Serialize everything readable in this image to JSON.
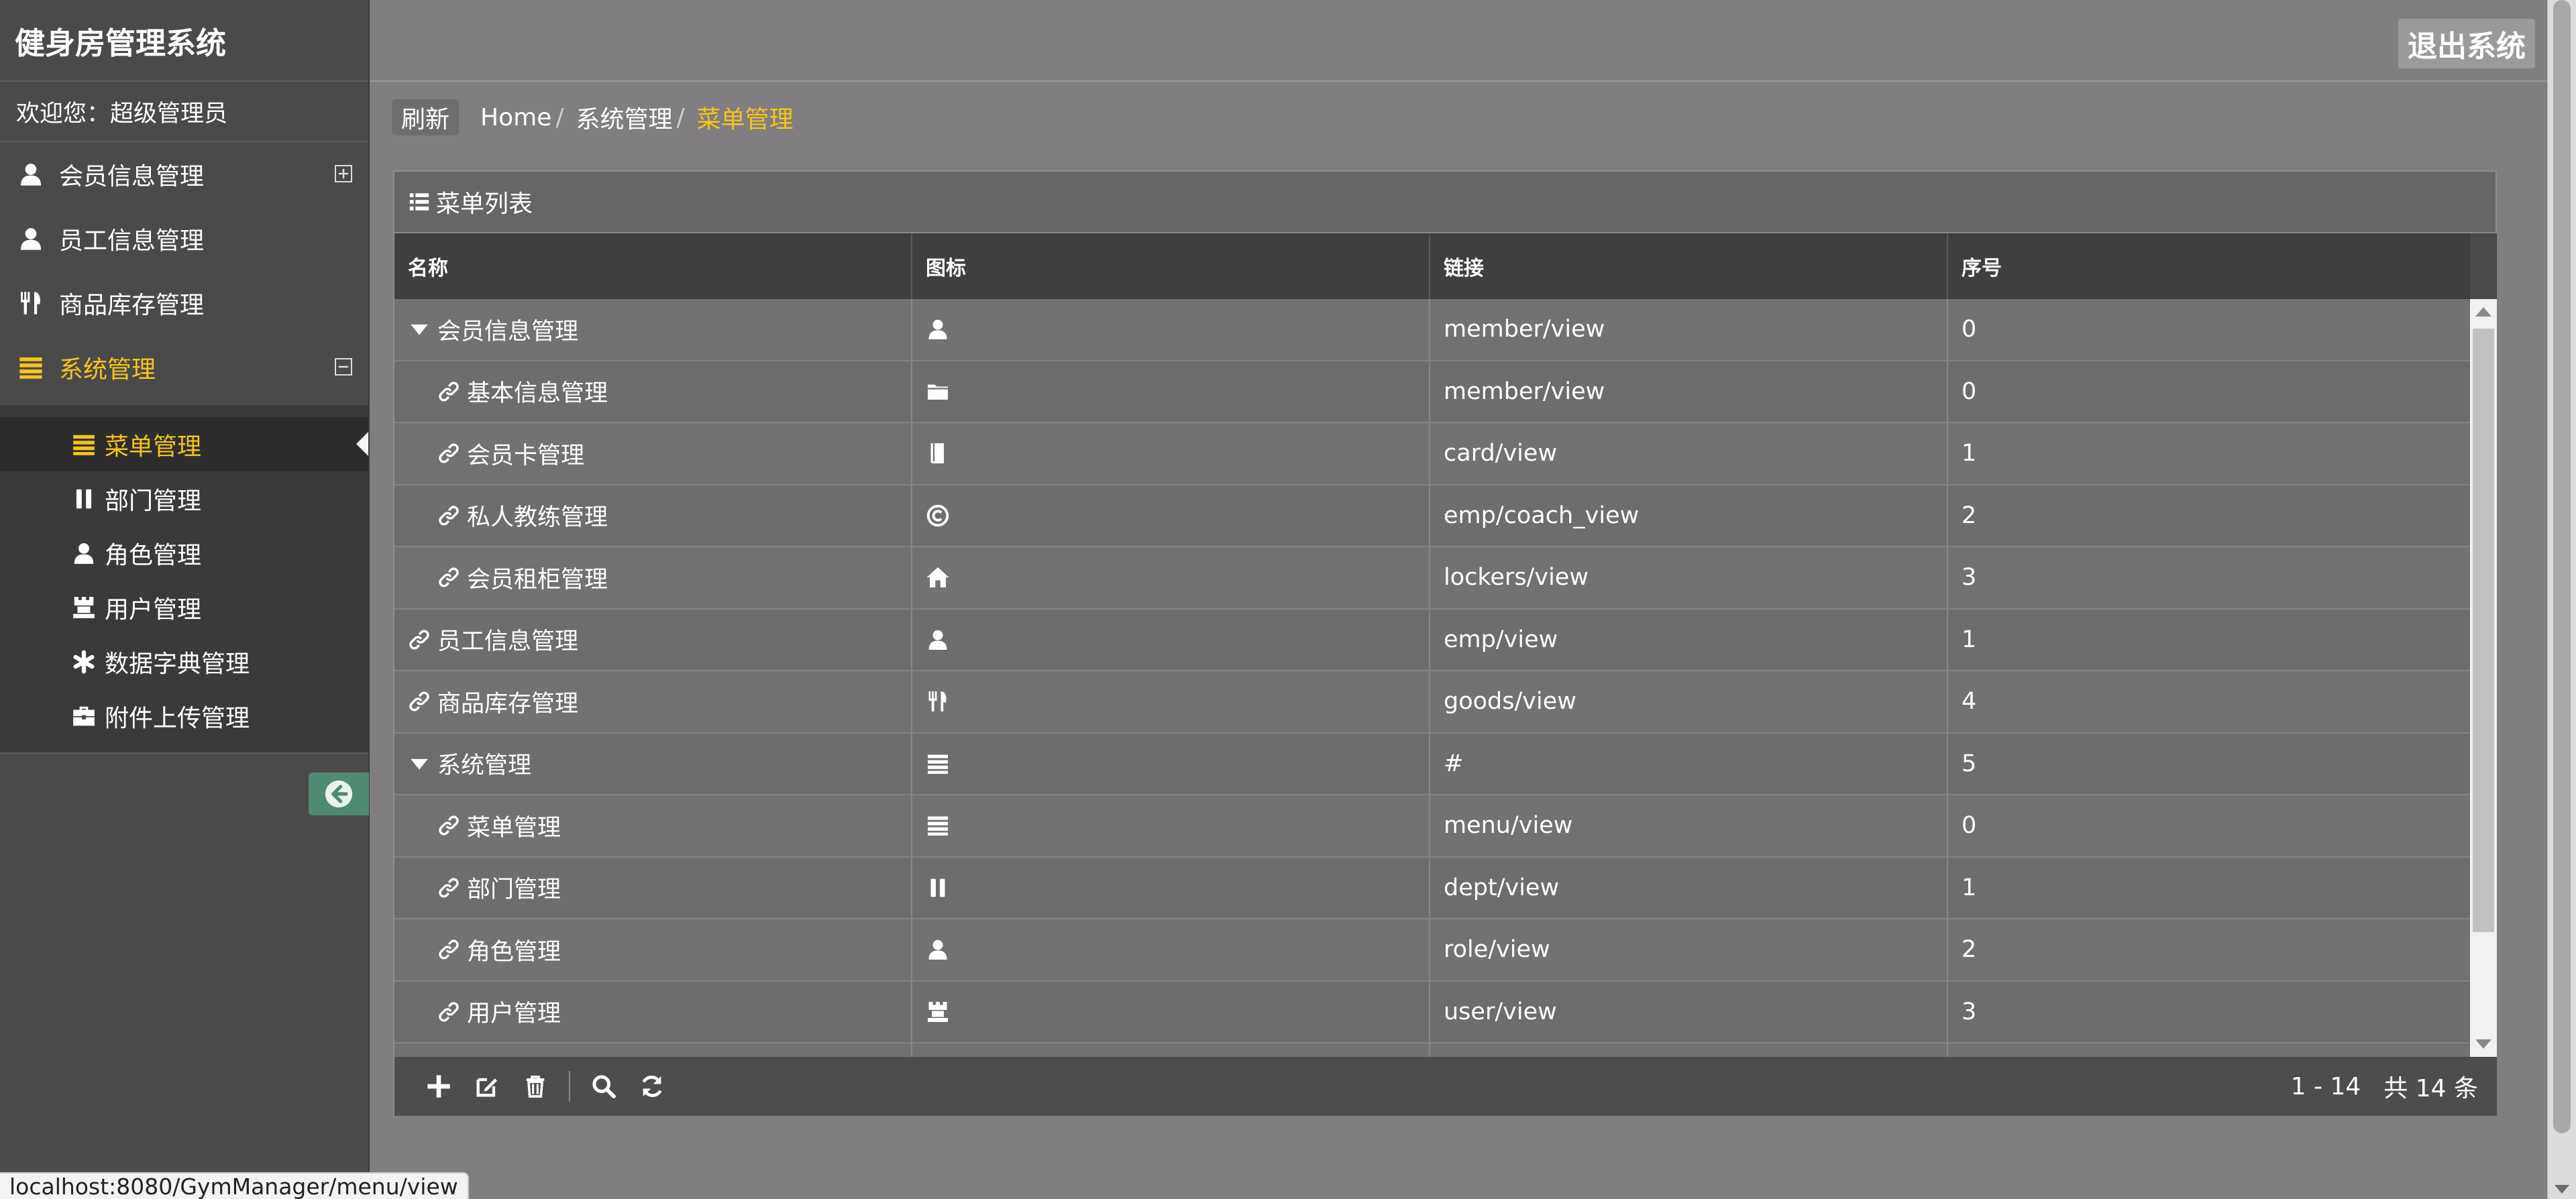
{
  "app": {
    "title": "健身房管理系统",
    "welcome": "欢迎您：超级管理员",
    "logout_label": "退出系统"
  },
  "sidebar": {
    "items": [
      {
        "label": "会员信息管理",
        "icon": "user-icon",
        "toggle": "plus"
      },
      {
        "label": "员工信息管理",
        "icon": "user-icon"
      },
      {
        "label": "商品库存管理",
        "icon": "cutlery-icon"
      },
      {
        "label": "系统管理",
        "icon": "list-icon",
        "toggle": "minus",
        "active": true
      }
    ],
    "subitems": [
      {
        "label": "菜单管理",
        "icon": "list-icon",
        "active": true
      },
      {
        "label": "部门管理",
        "icon": "pause-icon"
      },
      {
        "label": "角色管理",
        "icon": "user-icon"
      },
      {
        "label": "用户管理",
        "icon": "tower-icon"
      },
      {
        "label": "数据字典管理",
        "icon": "asterisk-icon"
      },
      {
        "label": "附件上传管理",
        "icon": "briefcase-icon"
      }
    ]
  },
  "breadcrumb": {
    "refresh_label": "刷新",
    "home": "Home",
    "parent": "系统管理",
    "current": "菜单管理"
  },
  "panel": {
    "title": "菜单列表"
  },
  "grid": {
    "columns": [
      "名称",
      "图标",
      "链接",
      "序号"
    ],
    "rows": [
      {
        "name": "会员信息管理",
        "icon": "user-icon",
        "link": "member/view",
        "order": "0",
        "level": 0,
        "node": "expanded"
      },
      {
        "name": "基本信息管理",
        "icon": "folder-icon",
        "link": "member/view",
        "order": "0",
        "level": 1,
        "node": "leaf"
      },
      {
        "name": "会员卡管理",
        "icon": "book-icon",
        "link": "card/view",
        "order": "1",
        "level": 1,
        "node": "leaf"
      },
      {
        "name": "私人教练管理",
        "icon": "copyright-icon",
        "link": "emp/coach_view",
        "order": "2",
        "level": 1,
        "node": "leaf"
      },
      {
        "name": "会员租柜管理",
        "icon": "home-icon",
        "link": "lockers/view",
        "order": "3",
        "level": 1,
        "node": "leaf"
      },
      {
        "name": "员工信息管理",
        "icon": "user-icon",
        "link": "emp/view",
        "order": "1",
        "level": 0,
        "node": "leaf"
      },
      {
        "name": "商品库存管理",
        "icon": "cutlery-icon",
        "link": "goods/view",
        "order": "4",
        "level": 0,
        "node": "leaf"
      },
      {
        "name": "系统管理",
        "icon": "list-icon",
        "link": "#",
        "order": "5",
        "level": 0,
        "node": "expanded"
      },
      {
        "name": "菜单管理",
        "icon": "list-icon",
        "link": "menu/view",
        "order": "0",
        "level": 1,
        "node": "leaf"
      },
      {
        "name": "部门管理",
        "icon": "pause-icon",
        "link": "dept/view",
        "order": "1",
        "level": 1,
        "node": "leaf"
      },
      {
        "name": "角色管理",
        "icon": "user-icon",
        "link": "role/view",
        "order": "2",
        "level": 1,
        "node": "leaf"
      },
      {
        "name": "用户管理",
        "icon": "tower-icon",
        "link": "user/view",
        "order": "3",
        "level": 1,
        "node": "leaf"
      }
    ]
  },
  "pager": {
    "range": "1 - 14",
    "total": "共 14 条"
  },
  "status_url": "localhost:8080/GymManager/menu/view",
  "colors": {
    "accent": "#f5c518",
    "sidebar": "#4a4a4a",
    "background": "#807e81"
  }
}
